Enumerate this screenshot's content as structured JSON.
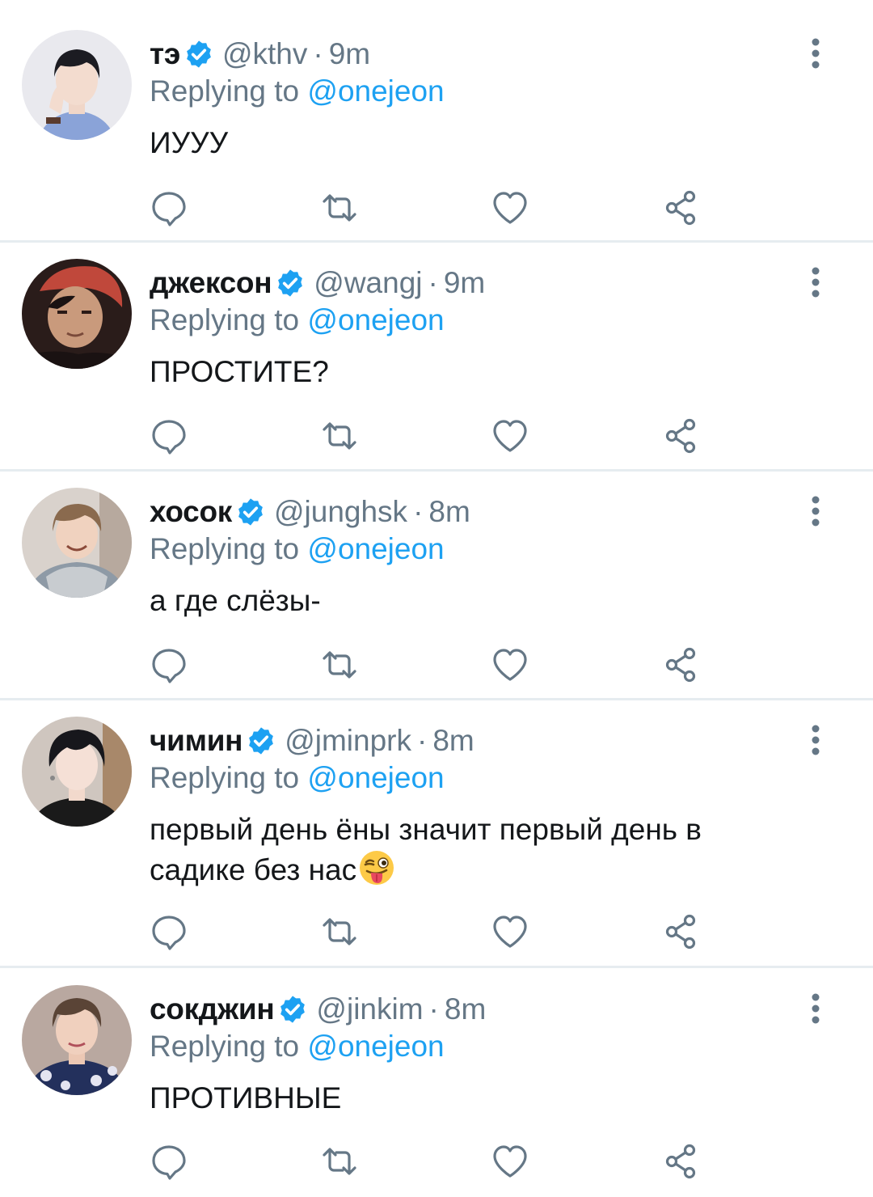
{
  "colors": {
    "text_primary": "#14171a",
    "text_secondary": "#657786",
    "accent": "#1da1f2",
    "divider": "#e6ecf0",
    "icon": "#657786"
  },
  "icons": {
    "verified": "verified-badge-icon",
    "more": "more-vertical-icon",
    "reply": "reply-bubble-icon",
    "retweet": "retweet-icon",
    "like": "heart-icon",
    "share": "share-icon"
  },
  "tweets": [
    {
      "name": "тэ",
      "handle": "@kthv",
      "separator": "·",
      "time": "9m",
      "replying_prefix": "Replying to",
      "replying_to": "@onejeon",
      "text": "ИУУУ"
    },
    {
      "name": "джексон",
      "handle": "@wangj",
      "separator": "·",
      "time": "9m",
      "replying_prefix": "Replying to",
      "replying_to": "@onejeon",
      "text": "ПРОСТИТЕ?"
    },
    {
      "name": "хосок",
      "handle": "@junghsk",
      "separator": "·",
      "time": "8m",
      "replying_prefix": "Replying to",
      "replying_to": "@onejeon",
      "text": "а где слёзы-"
    },
    {
      "name": "чимин",
      "handle": "@jminprk",
      "separator": "·",
      "time": "8m",
      "replying_prefix": "Replying to",
      "replying_to": "@onejeon",
      "text_line1": "первый день ёны значит первый день в",
      "text_line2": "садике без нас",
      "emoji": "😜"
    },
    {
      "name": "сокджин",
      "handle": "@jinkim",
      "separator": "·",
      "time": "8m",
      "replying_prefix": "Replying to",
      "replying_to": "@onejeon",
      "text": "ПРОТИВНЫЕ"
    }
  ]
}
